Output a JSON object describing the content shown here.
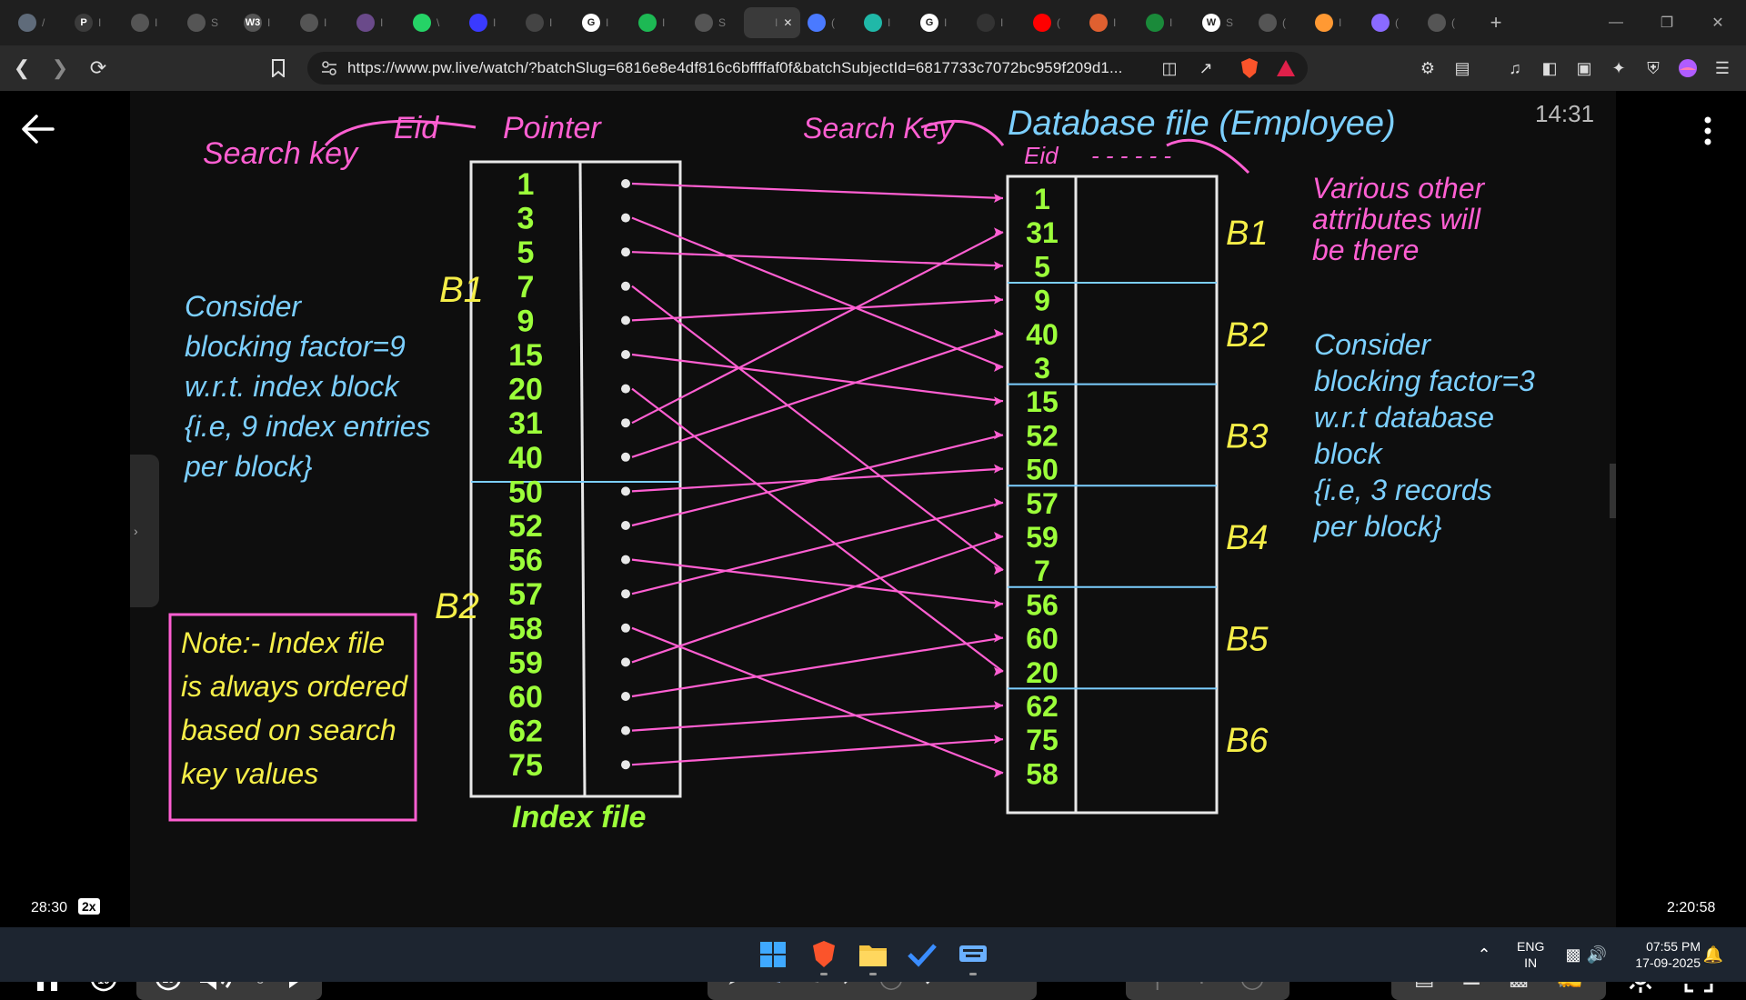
{
  "browser": {
    "tabs": [
      {
        "icon": "chatgpt-icon",
        "letter": "",
        "color": "#5f6b7a",
        "sep": "/"
      },
      {
        "icon": "pw-logo-icon",
        "letter": "P",
        "color": "#3b3b3b",
        "sep": "I"
      },
      {
        "icon": "globe-icon",
        "letter": "",
        "color": "#555",
        "sep": "I"
      },
      {
        "icon": "globe-icon",
        "letter": "",
        "color": "#555",
        "sep": "S"
      },
      {
        "icon": "w3schools-icon",
        "letter": "W3",
        "color": "#555",
        "sep": "I"
      },
      {
        "icon": "globe-icon",
        "letter": "",
        "color": "#555",
        "sep": "I"
      },
      {
        "icon": "purple-logo-icon",
        "letter": "",
        "color": "#6a4a8a",
        "sep": "I"
      },
      {
        "icon": "whatsapp-icon",
        "letter": "",
        "color": "#25d366",
        "sep": "\\"
      },
      {
        "icon": "blue-logo-icon",
        "letter": "",
        "color": "#3a3aff",
        "sep": "I"
      },
      {
        "icon": "orbit-icon",
        "letter": "",
        "color": "#444",
        "sep": "I"
      },
      {
        "icon": "google-icon",
        "letter": "G",
        "color": "#ffffff",
        "sep": "I"
      },
      {
        "icon": "spotify-icon",
        "letter": "",
        "color": "#1db954",
        "sep": "I"
      },
      {
        "icon": "globe-icon",
        "letter": "",
        "color": "#555",
        "sep": "S"
      },
      {
        "icon": "active-tab-icon",
        "letter": "",
        "color": "#3a3a3a",
        "sep": "I",
        "active": true
      },
      {
        "icon": "gemini-icon",
        "letter": "",
        "color": "#4a7aff",
        "sep": "("
      },
      {
        "icon": "perplexity-icon",
        "letter": "",
        "color": "#20b8a8",
        "sep": "I"
      },
      {
        "icon": "google-icon",
        "letter": "G",
        "color": "#ffffff",
        "sep": "I"
      },
      {
        "icon": "window-icon",
        "letter": "",
        "color": "#333",
        "sep": "I"
      },
      {
        "icon": "youtube-icon",
        "letter": "",
        "color": "#ff0000",
        "sep": "("
      },
      {
        "icon": "orange-logo-icon",
        "letter": "",
        "color": "#e06030",
        "sep": "I"
      },
      {
        "icon": "green-chart-icon",
        "letter": "",
        "color": "#1a8a3a",
        "sep": "I"
      },
      {
        "icon": "wikipedia-icon",
        "letter": "W",
        "color": "#ffffff",
        "sep": "S"
      },
      {
        "icon": "globe-icon",
        "letter": "",
        "color": "#555",
        "sep": "("
      },
      {
        "icon": "india-flag-icon",
        "letter": "",
        "color": "#ff9933",
        "sep": "I"
      },
      {
        "icon": "purple-circle-icon",
        "letter": "",
        "color": "#8a6aff",
        "sep": "("
      },
      {
        "icon": "globe-icon",
        "letter": "",
        "color": "#555",
        "sep": "("
      }
    ],
    "url": "https://www.pw.live/watch/?batchSlug=6816e8e4df816c6bffffaf0f&batchSubjectId=6817733c7072bc959f209d1..."
  },
  "video": {
    "clock": "14:31",
    "board": {
      "search_key_left": "Search key",
      "eid_header": "Eid",
      "pointer_header": "Pointer",
      "search_key_right": "Search Key",
      "database_file": "Database file (Employee)",
      "db_eid_header": "Eid",
      "db_dashes": "- - - - - -",
      "index_file_label": "Index file",
      "index_values": [
        "1",
        "3",
        "5",
        "7",
        "9",
        "15",
        "20",
        "31",
        "40",
        "50",
        "52",
        "56",
        "57",
        "58",
        "59",
        "60",
        "62",
        "75"
      ],
      "index_block_labels": [
        "B1",
        "B2"
      ],
      "db_values": [
        "1",
        "31",
        "5",
        "9",
        "40",
        "3",
        "15",
        "52",
        "50",
        "57",
        "59",
        "7",
        "56",
        "60",
        "20",
        "62",
        "75",
        "58"
      ],
      "db_block_labels": [
        "B1",
        "B2",
        "B3",
        "B4",
        "B5",
        "B6"
      ],
      "left_notes": [
        "Consider",
        "blocking factor=9",
        "w.r.t. index block",
        "{i.e, 9 index entries",
        "per block}"
      ],
      "note_box": [
        "Note:- Index file",
        "is always ordered",
        "based on search",
        "key values"
      ],
      "right_notes_top": [
        "Various other",
        "attributes will",
        "be there"
      ],
      "right_notes": [
        "Consider",
        "blocking factor=3",
        "w.r.t database",
        "block",
        "{i.e, 3 records",
        "per block}"
      ]
    },
    "player": {
      "current_time": "28:30",
      "speed": "2x",
      "duration": "2:20:58",
      "progress": 0.202,
      "buffered": 0.21,
      "rewind_label": "10",
      "forward_label": "10",
      "volume_badge": "6"
    }
  },
  "taskbar": {
    "lang_top": "ENG",
    "lang_bottom": "IN",
    "time": "07:55 PM",
    "date": "17-09-2025"
  },
  "colors": {
    "pink": "#ff5fd2",
    "green": "#9cff3a",
    "yellow": "#f5ee48",
    "blue": "#7ccfff",
    "progress": "#5b5bff"
  }
}
